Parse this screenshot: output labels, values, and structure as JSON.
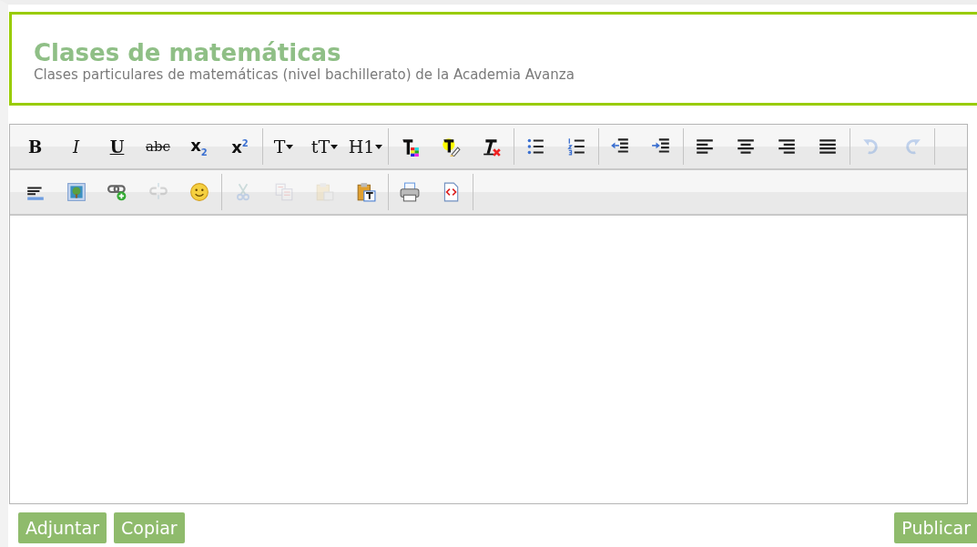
{
  "header": {
    "title": "Clases de matemáticas",
    "subtitle": "Clases particulares de matemáticas (nivel bachillerato) de la Academia Avanza"
  },
  "toolbar": {
    "rows": [
      {
        "groups": [
          {
            "buttons": [
              {
                "kind": "text",
                "label": "B",
                "disabled": false
              },
              {
                "kind": "text",
                "label": "I",
                "disabled": false
              },
              {
                "kind": "text",
                "label": "U",
                "disabled": false
              },
              {
                "kind": "text",
                "label": "abc",
                "disabled": false
              },
              {
                "kind": "text",
                "label": "x$_{2}$",
                "disabled": false
              },
              {
                "kind": "text",
                "label": "x$^{2}$",
                "disabled": false
              }
            ]
          },
          {
            "buttons": [
              {
                "kind": "text",
                "label": "T",
                "dropdown": true,
                "disabled": false
              },
              {
                "kind": "text",
                "label": "tT",
                "dropdown": true,
                "disabled": false
              },
              {
                "kind": "text",
                "label": "H1",
                "dropdown": true,
                "disabled": false
              }
            ]
          },
          {
            "buttons": [
              {
                "kind": "icon",
                "disabled": false
              },
              {
                "kind": "icon",
                "disabled": false
              },
              {
                "kind": "icon",
                "disabled": false
              }
            ]
          },
          {
            "buttons": [
              {
                "kind": "icon",
                "disabled": false
              },
              {
                "kind": "icon",
                "disabled": false
              }
            ]
          },
          {
            "buttons": [
              {
                "kind": "icon",
                "disabled": false
              },
              {
                "kind": "icon",
                "disabled": false
              }
            ]
          },
          {
            "buttons": [
              {
                "kind": "icon",
                "disabled": false
              },
              {
                "kind": "icon",
                "disabled": false
              },
              {
                "kind": "icon",
                "disabled": false
              },
              {
                "kind": "icon",
                "disabled": false
              }
            ]
          },
          {
            "buttons": [
              {
                "kind": "icon",
                "disabled": true
              },
              {
                "kind": "icon",
                "disabled": true
              }
            ]
          }
        ]
      },
      {
        "groups": [
          {
            "buttons": [
              {
                "kind": "icon",
                "disabled": false
              },
              {
                "kind": "icon",
                "disabled": false
              },
              {
                "kind": "icon",
                "disabled": false
              },
              {
                "kind": "icon",
                "disabled": true
              },
              {
                "kind": "icon",
                "disabled": false
              }
            ]
          },
          {
            "buttons": [
              {
                "kind": "icon",
                "disabled": true
              },
              {
                "kind": "icon",
                "disabled": true
              },
              {
                "kind": "icon",
                "disabled": true
              },
              {
                "kind": "icon",
                "disabled": false
              }
            ]
          },
          {
            "buttons": [
              {
                "kind": "icon",
                "disabled": false
              },
              {
                "kind": "icon",
                "disabled": false
              }
            ]
          }
        ]
      }
    ]
  },
  "actions": {
    "left": [
      "Adjuntar",
      "Copiar"
    ],
    "right": [
      "Publicar"
    ]
  }
}
